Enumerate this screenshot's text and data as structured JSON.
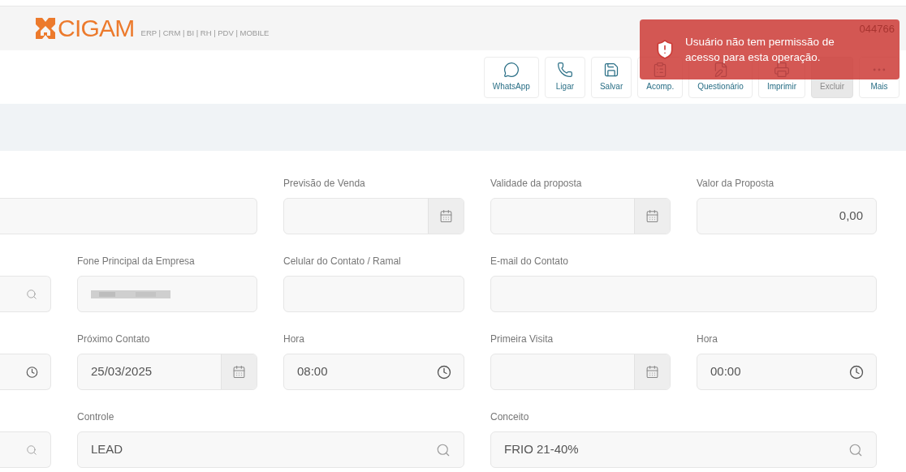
{
  "header": {
    "logo": "CIGAM",
    "tagline": "ERP | CRM | BI | RH | PDV | MOBILE",
    "code": "044766"
  },
  "toast": {
    "message": "Usuário não tem permissão de acesso para esta operação."
  },
  "toolbar": [
    {
      "label": "WhatsApp",
      "kind": "whatsapp",
      "disabled": false
    },
    {
      "label": "Ligar",
      "kind": "phone",
      "disabled": false
    },
    {
      "label": "Salvar",
      "kind": "save",
      "disabled": false
    },
    {
      "label": "Acomp.",
      "kind": "clipboard",
      "disabled": false
    },
    {
      "label": "Questionário",
      "kind": "form",
      "disabled": false
    },
    {
      "label": "Imprimir",
      "kind": "printer",
      "disabled": false
    },
    {
      "label": "Excluir",
      "kind": "delete",
      "disabled": true
    },
    {
      "label": "Mais",
      "kind": "more",
      "disabled": false
    }
  ],
  "form_rows": [
    [
      {
        "kind": "text"
      },
      {
        "kind": "date",
        "label": "Previsão de Venda"
      },
      {
        "kind": "date",
        "label": "Validade da proposta"
      },
      {
        "kind": "number",
        "label": "Valor da Proposta",
        "value": "0,00"
      }
    ],
    [
      {
        "kind": "lookup"
      },
      {
        "kind": "redacted",
        "label": "Fone Principal da Empresa"
      },
      {
        "kind": "text",
        "label": "Celular do Contato / Ramal"
      },
      {
        "kind": "text",
        "label": "E-mail do Contato"
      }
    ],
    [
      {
        "kind": "time"
      },
      {
        "kind": "date",
        "label": "Próximo Contato",
        "value": "25/03/2025"
      },
      {
        "kind": "time",
        "label": "Hora",
        "value": "08:00"
      },
      {
        "kind": "date",
        "label": "Primeira Visita"
      },
      {
        "kind": "time",
        "label": "Hora",
        "value": "00:00"
      }
    ],
    [
      {
        "kind": "lookup"
      },
      {
        "kind": "lookup",
        "label": "Controle",
        "value": "LEAD"
      },
      {
        "kind": "lookup",
        "label": "Conceito",
        "value": "FRIO 21-40%"
      }
    ]
  ]
}
